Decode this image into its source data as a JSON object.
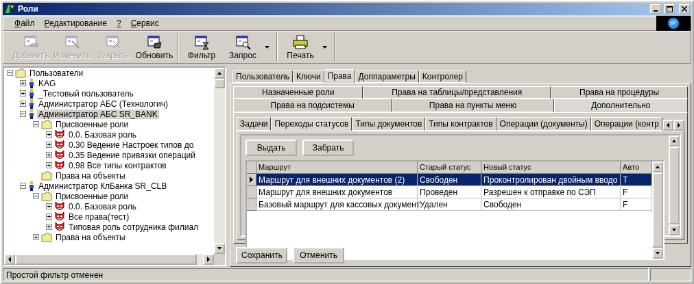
{
  "window": {
    "title": "Роли"
  },
  "menu": [
    {
      "label": "Файл"
    },
    {
      "label": "Редактирование"
    },
    {
      "label": "?"
    },
    {
      "label": "Сервис"
    }
  ],
  "toolbar": [
    {
      "buttons": [
        {
          "label": "Добавить",
          "disabled": true,
          "dropdown": false
        },
        {
          "label": "Изменить",
          "disabled": true,
          "dropdown": false
        },
        {
          "label": "Закрыть",
          "disabled": true,
          "dropdown": false
        },
        {
          "label": "Обновить",
          "disabled": false,
          "dropdown": false
        }
      ]
    },
    {
      "buttons": [
        {
          "label": "Фильтр",
          "disabled": false,
          "dropdown": false
        },
        {
          "label": "Запрос",
          "disabled": false,
          "dropdown": true
        }
      ]
    },
    {
      "buttons": [
        {
          "label": "Печать",
          "disabled": false,
          "dropdown": true
        }
      ]
    }
  ],
  "tree": [
    {
      "kind": "folder",
      "label": "Пользователи",
      "expanded": true,
      "selected": false,
      "children": [
        {
          "kind": "user",
          "label": "KAG",
          "expanded": false,
          "selected": false
        },
        {
          "kind": "user",
          "label": "_Тестовый пользователь",
          "expanded": false,
          "selected": false
        },
        {
          "kind": "user",
          "label": "Администратор АБС (Технологич)",
          "expanded": false,
          "selected": false
        },
        {
          "kind": "user",
          "label": "Администратор АБС SR_BANK",
          "expanded": true,
          "selected": true,
          "children": [
            {
              "kind": "folder",
              "label": "Присвоенные роли",
              "expanded": true,
              "selected": false,
              "children": [
                {
                  "kind": "role",
                  "label": "0.0. Базовая роль",
                  "expanded": false,
                  "selected": false
                },
                {
                  "kind": "role",
                  "label": "0.30 Ведение Настроек типов до",
                  "expanded": false,
                  "selected": false
                },
                {
                  "kind": "role",
                  "label": "0.35 Ведение привязки операций",
                  "expanded": false,
                  "selected": false
                },
                {
                  "kind": "role",
                  "label": "0.98 Все типы контрактов",
                  "expanded": false,
                  "selected": false
                }
              ]
            },
            {
              "kind": "folder",
              "label": "Права на объекты",
              "selected": false
            }
          ]
        },
        {
          "kind": "user",
          "label": "Администратор КлБанка SR_CLB",
          "expanded": true,
          "selected": false,
          "children": [
            {
              "kind": "folder",
              "label": "Присвоенные роли",
              "expanded": true,
              "selected": false,
              "children": [
                {
                  "kind": "role",
                  "label": "0.0. Базовая роль",
                  "expanded": false,
                  "selected": false
                },
                {
                  "kind": "role",
                  "label": "Все права(тест)",
                  "expanded": false,
                  "selected": false
                },
                {
                  "kind": "role",
                  "label": "Типовая роль сотрудника филиал",
                  "expanded": false,
                  "selected": false
                }
              ]
            },
            {
              "kind": "folder",
              "label": "Права на объекты",
              "expanded": false,
              "selected": false
            }
          ]
        }
      ]
    }
  ],
  "tabs": [
    {
      "label": "Пользователь",
      "selected": false
    },
    {
      "label": "Ключи",
      "selected": false
    },
    {
      "label": "Права",
      "selected": true
    },
    {
      "label": "Доппараметры",
      "selected": false
    },
    {
      "label": "Контролер",
      "selected": false
    }
  ],
  "rights_tabs": [
    [
      {
        "label": "Назначенные роли",
        "selected": false
      },
      {
        "label": "Права на таблицы/представления",
        "selected": false
      },
      {
        "label": "Права на процедуры",
        "selected": false
      }
    ],
    [
      {
        "label": "Права на подсистемы",
        "selected": false
      },
      {
        "label": "Права на пункты меню",
        "selected": false
      },
      {
        "label": "Дополнительно",
        "selected": true
      }
    ]
  ],
  "detail_tabs": [
    {
      "label": "Задачи",
      "selected": false
    },
    {
      "label": "Переходы статусов",
      "selected": true
    },
    {
      "label": "Типы документов",
      "selected": false
    },
    {
      "label": "Типы контрактов",
      "selected": false
    },
    {
      "label": "Операции (документы)",
      "selected": false
    },
    {
      "label": "Операции (контр",
      "selected": false
    }
  ],
  "actions": [
    {
      "label": "Выдать"
    },
    {
      "label": "Забрать"
    }
  ],
  "table": {
    "columns": [
      "Маршрут",
      "Старый статус",
      "Новый статус",
      "Авто"
    ],
    "rows": [
      {
        "cells": [
          "Маршрут для внешних документов (2)",
          "Свободен",
          "Проконтролирован двойным вводо",
          "T"
        ],
        "selected": true
      },
      {
        "cells": [
          "Маршрут для внешних документов",
          "Проведен",
          "Разрешен к отправке по СЭП",
          "F"
        ],
        "selected": false
      },
      {
        "cells": [
          "Базовый маршрут для кассовых документ",
          "Удален",
          "Свободен",
          "F"
        ],
        "selected": false
      }
    ]
  },
  "footer_buttons": [
    {
      "label": "Сохранить"
    },
    {
      "label": "Отменить"
    }
  ],
  "status_bar": {
    "text": "Простой фильтр отменен"
  }
}
